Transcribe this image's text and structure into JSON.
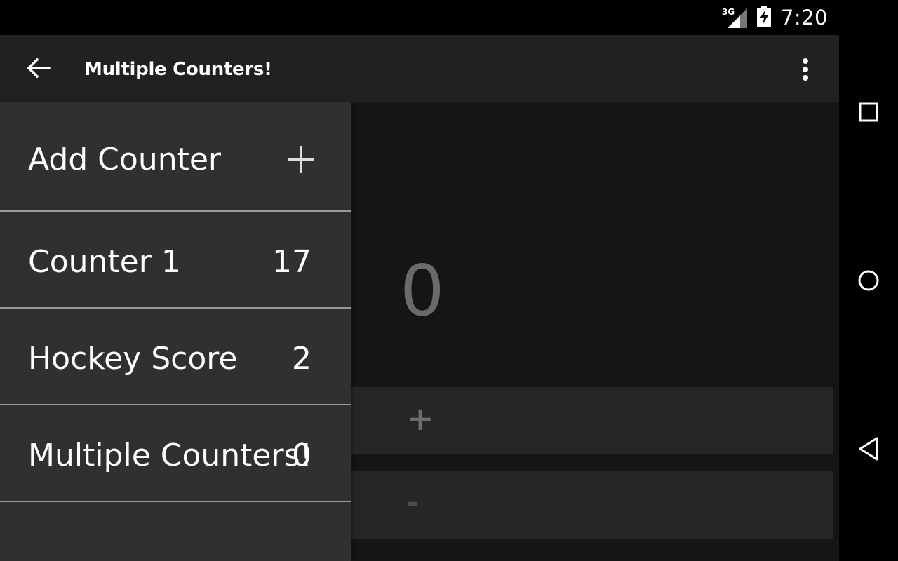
{
  "status_bar": {
    "network": "3G",
    "time": "7:20",
    "icons": [
      "signal-icon",
      "battery-charging-icon"
    ]
  },
  "app_bar": {
    "title": "Multiple Counters!",
    "icons": [
      "back-arrow-icon",
      "overflow-menu-icon"
    ]
  },
  "main": {
    "counter_value": "0",
    "increment_label": "+",
    "decrement_label": "-"
  },
  "drawer": {
    "add_item": {
      "label": "Add Counter",
      "icon": "plus-icon"
    },
    "counters": [
      {
        "name": "Counter 1",
        "count": "17"
      },
      {
        "name": "Hockey Score",
        "count": "2"
      },
      {
        "name": "Multiple Counters!",
        "count": "0"
      }
    ]
  },
  "nav_bar": {
    "icons": [
      "recents-icon",
      "home-icon",
      "back-icon"
    ]
  }
}
